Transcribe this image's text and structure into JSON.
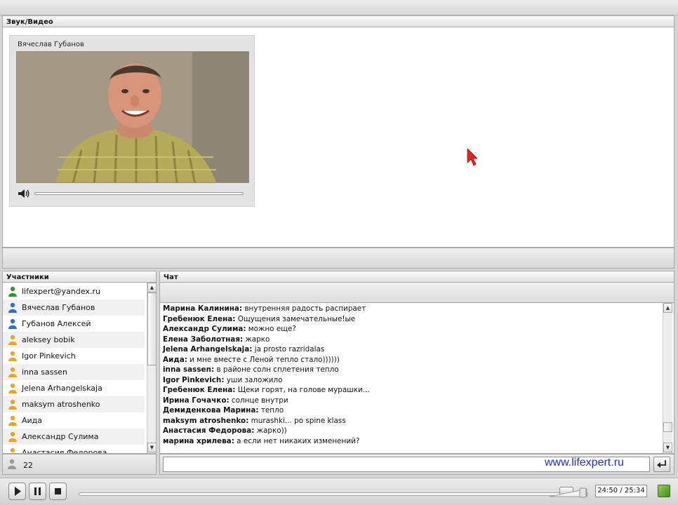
{
  "av_panel": {
    "title": "Звук/Видео",
    "speaker_name": "Вячеслав Губанов",
    "volume_icon": "speaker-volume-icon"
  },
  "participants": {
    "title": "Участники",
    "count": "22",
    "items": [
      {
        "name": "lifexpert@yandex.ru",
        "role": "host",
        "color": "#2e9a2e"
      },
      {
        "name": "Вячеслав Губанов",
        "role": "presenter",
        "color": "#2f6fd0"
      },
      {
        "name": "Губанов Алексей",
        "role": "presenter",
        "color": "#2f6fd0"
      },
      {
        "name": "aleksey bobik",
        "role": "listener",
        "color": "#f0a418"
      },
      {
        "name": "Igor Pinkevich",
        "role": "listener",
        "color": "#f0a418"
      },
      {
        "name": "inna sassen",
        "role": "listener",
        "color": "#f0a418"
      },
      {
        "name": "Jelena Arhangelskaja",
        "role": "listener",
        "color": "#f0a418"
      },
      {
        "name": "maksym atroshenko",
        "role": "listener",
        "color": "#f0a418"
      },
      {
        "name": "Аида",
        "role": "listener",
        "color": "#f0a418"
      },
      {
        "name": "Александр Сулима",
        "role": "listener",
        "color": "#f0a418"
      },
      {
        "name": "Анастасия Федорова",
        "role": "listener",
        "color": "#f0a418"
      }
    ]
  },
  "chat": {
    "title": "Чат",
    "messages": [
      {
        "author": "Марина Калинина:",
        "text": " внутренняя радость распирает"
      },
      {
        "author": "Гребенюк Елена:",
        "text": " Ощущения замечательные!ые"
      },
      {
        "author": "Александр Сулима:",
        "text": " можно еще?"
      },
      {
        "author": "Елена Заболотная:",
        "text": " жарко"
      },
      {
        "author": "Jelena Arhangelskaja:",
        "text": " ja prosto razridalas"
      },
      {
        "author": "Аида:",
        "text": " и мне вместе с Леной тепло стало))))))"
      },
      {
        "author": "inna sassen:",
        "text": " в районе солн сплетения тепло"
      },
      {
        "author": "Igor Pinkevich:",
        "text": " уши заложило"
      },
      {
        "author": "Гребенюк Елена:",
        "text": " Щеки горят, на голове мурашки..."
      },
      {
        "author": "Ирина Гочачко:",
        "text": " солнце внутри"
      },
      {
        "author": "Демиденкова Марина:",
        "text": " тепло"
      },
      {
        "author": "maksym atroshenko:",
        "text": " murashki... po spine klass"
      },
      {
        "author": "Анастасия Федорова:",
        "text": " жарко))"
      },
      {
        "author": "марина хрилева:",
        "text": " а если нет никаких изменений?"
      }
    ],
    "input_value": "",
    "watermark": "www.lifexpert.ru",
    "send_icon": "enter-arrow-icon"
  },
  "player": {
    "time": "24:50 / 25:34",
    "progress": 0.971,
    "volume": 0.9
  },
  "colors": {
    "watermark": "#1e2fc6",
    "cursor": "#e0261b",
    "host": "#2e9a2e",
    "presenter": "#2f6fd0",
    "listener": "#f0a418"
  }
}
